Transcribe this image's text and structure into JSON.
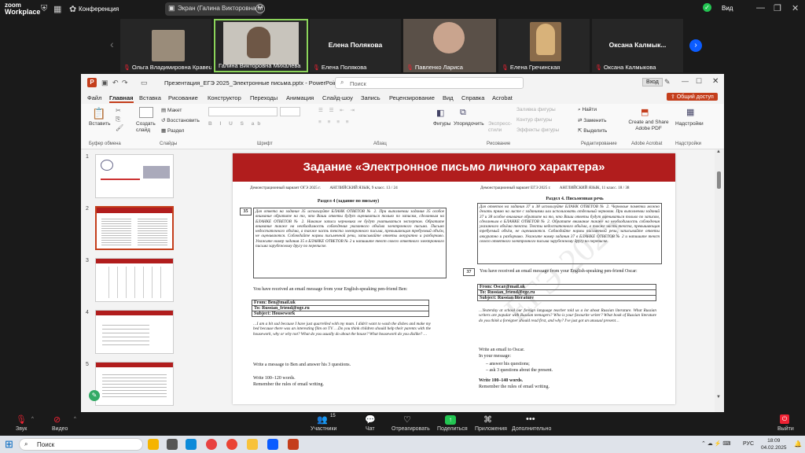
{
  "zoom": {
    "logo_line1": "zoom",
    "logo_line2": "Workplace",
    "conference_label": "Конференция",
    "share_label": "Экран (Галина Викторовна Ми",
    "view_label": "Вид"
  },
  "participants": [
    {
      "name": "Ольга Владимировна Кравец",
      "big": ""
    },
    {
      "name": "Галина Викторовна Михалева",
      "big": ""
    },
    {
      "name": "Елена Полякова",
      "big": "Елена Полякова"
    },
    {
      "name": "Павленко Лариса",
      "big": ""
    },
    {
      "name": "Елена Гречинская",
      "big": ""
    },
    {
      "name": "Оксана Калмыкова",
      "big": "Оксана  Калмык..."
    }
  ],
  "ppt": {
    "title": "Презентация_ЕГЭ 2025_Электронные письма.pptx  -  PowerPoint",
    "search_placeholder": "Поиск",
    "signin": "Вход",
    "menu": [
      "Файл",
      "Главная",
      "Вставка",
      "Рисование",
      "Конструктор",
      "Переходы",
      "Анимация",
      "Слайд-шоу",
      "Запись",
      "Рецензирование",
      "Вид",
      "Справка",
      "Acrobat"
    ],
    "share_button": "Общий доступ",
    "ribbon": {
      "paste": "Вставить",
      "create_slide": "Создать слайд",
      "layout": "Макет",
      "reset": "Восстановить",
      "section": "Раздел",
      "grp_clipboard": "Буфер обмена",
      "grp_slides": "Слайды",
      "grp_font": "Шрифт",
      "grp_paragraph": "Абзац",
      "grp_drawing": "Рисование",
      "grp_editing": "Редактирование",
      "grp_acrobat": "Adobe Acrobat",
      "grp_addins": "Надстройки",
      "shapes": "Фигуры",
      "arrange": "Упорядочить",
      "express": "Экспресс-стили",
      "fill": "Заливка фигуры",
      "outline": "Контур фигуры",
      "effects": "Эффекты фигуры",
      "find": "Найти",
      "replace": "Заменить",
      "select": "Выделить",
      "adobe": "Create and Share Adobe PDF",
      "addins": "Надстройки"
    },
    "thumb_numbers": [
      "1",
      "2",
      "3",
      "4",
      "5"
    ]
  },
  "slide": {
    "title": "Задание    «Электронное письмо личного характера»",
    "left": {
      "header_a": "Демонстрационный вариант ОГЭ 2025 г.",
      "header_b": "АНГЛИЙСКИЙ ЯЗЫК, 9 класс.    13 / 24",
      "section": "Раздел 4 (задание по письму)",
      "task_num": "35",
      "instructions": "Для ответа на задание 35 используйте БЛАНК ОТВЕТОВ № 2. При выполнении задания 35 особое внимание обратите на то, что Ваши ответы будут оцениваться только по записям, сделанным на БЛАНКЕ ОТВЕТОВ № 2. Никакие записи черновика не будут учитываться экспертом. Обратите внимание также на необходимость соблюдения указанного объёма электронного письма. Письмо недостаточного объёма, а также часть текста электронного письма, превышающая требуемый объём, не оцениваются. Соблюдайте нормы письменной речи, записывайте ответы аккуратно и разборчиво. Укажите номер задания 35 в БЛАНКЕ ОТВЕТОВ № 2 и напишите текст своего ответного электронного письма зарубежному другу по переписке.",
      "intro": "You have received an email message from your English-speaking pen-friend Ben:",
      "from": "From: Ben@mail.uk",
      "to": "To: Russian_friend@oge.ru",
      "subject": "Subject: Housework",
      "body": "…I am a bit sad because I have just quarrelled with my mum. I didn't want to wash the dishes and make my bed because there was an interesting film on TV. …Do you think children should help their parents with the housework, why or why not? What do you usually do about the house? What housework do you dislike? …",
      "task": "Write a message to Ben and answer his 3 questions.",
      "words": "Write 100–120 words.",
      "remember": "Remember the rules of email writing."
    },
    "right": {
      "header_a": "Демонстрационный вариант ЕГЭ 2025 г.",
      "header_b": "АНГЛИЙСКИЙ ЯЗЫК, 11 класс.    18 / 38",
      "section": "Раздел 4. Письменная речь",
      "instructions": "Для ответов на задания 37 и 38 используйте БЛАНК ОТВЕТОВ № 2. Черновые пометки можно делать прямо на листе с заданиями или использовать отдельный черновик. При выполнении заданий 37 и 38 особое внимание обратите на то, что Ваши ответы будут оцениваться только по записям, сделанным в БЛАНКЕ ОТВЕТОВ № 2. Обратите внимание также на необходимость соблюдения указанного объёма текста. Тексты недостаточного объёма, а также часть текста, превышающая требуемый объём, не оцениваются. Соблюдайте нормы письменной речи, записывайте ответы аккуратно и разборчиво. Укажите номер задания 37 в БЛАНКЕ ОТВЕТОВ № 2 и напишите текст своего ответного электронного письма зарубежному другу по переписке.",
      "task_num": "37",
      "intro": "You have received an email message from your English-speaking pen-friend Oscar:",
      "from": "From: Oscar@mail.uk",
      "to": "To: Russian_friend@ege.ru",
      "subject": "Subject: Russian literature",
      "body": "…Yesterday at school our foreign language teacher told us a lot about Russian literature. What Russian writers are popular with Russian teenagers? Who is your favourite writer? What book of Russian literature do you think a foreigner should read first, and why? I've just got an unusual present…",
      "task1": "Write an email to Oscar.",
      "task2": "In your message:",
      "bullet1": "answer his questions;",
      "bullet2": "ask 3 questions about the present.",
      "words": "Write 100–140 words.",
      "remember": "Remember the rules of email writing."
    }
  },
  "controls": {
    "audio": "Звук",
    "video": "Видео",
    "participants": "Участники",
    "participants_count": "15",
    "chat": "Чат",
    "react": "Отреагировать",
    "share": "Поделиться",
    "apps": "Приложения",
    "more": "Дополнительно",
    "leave": "Выйти"
  },
  "taskbar": {
    "search": "Поиск",
    "lang": "РУС",
    "time": "18:09",
    "date": "04.02.2025"
  },
  "colors": {
    "accent_red": "#b11d1d",
    "ppt_orange": "#c43e1c",
    "zoom_blue": "#0b5cff",
    "share_green": "#23c552"
  }
}
